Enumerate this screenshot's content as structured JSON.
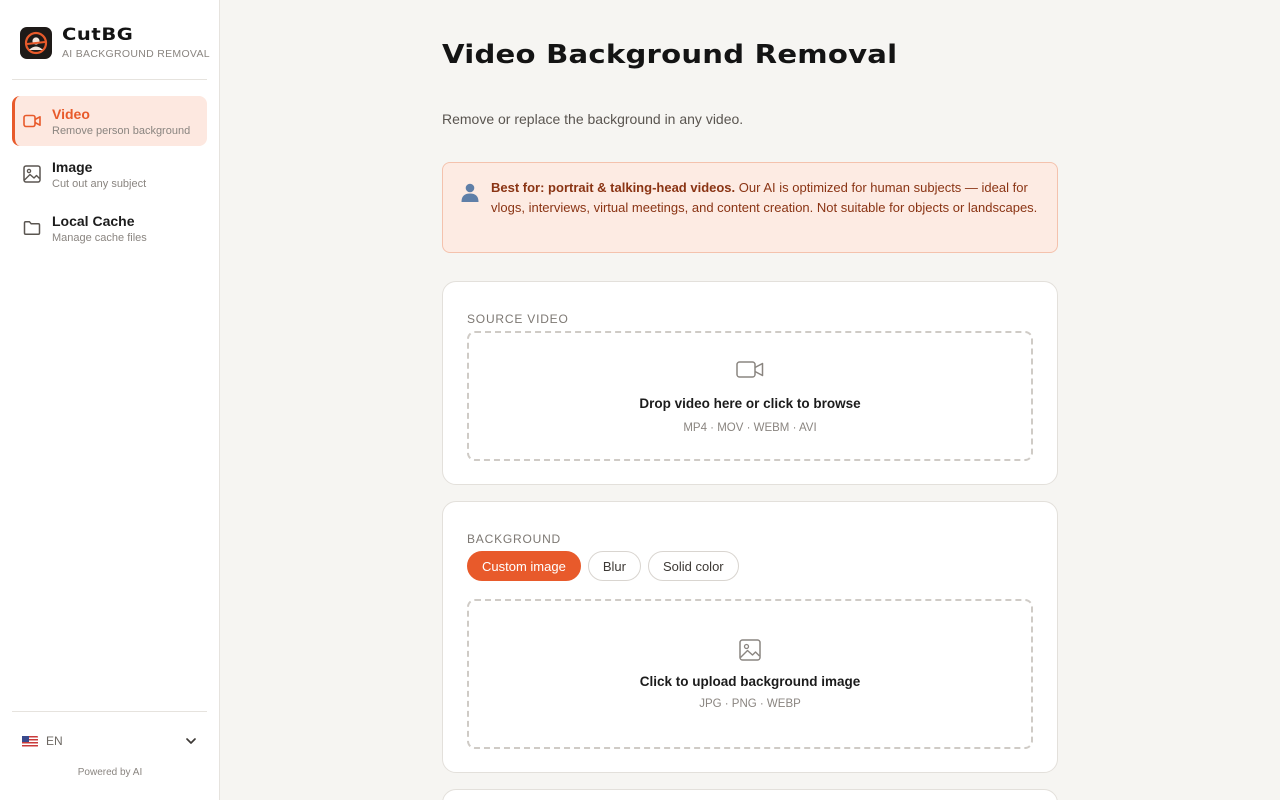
{
  "brand": {
    "name": "CutBG",
    "tagline": "AI BACKGROUND REMOVAL"
  },
  "sidebar": {
    "items": [
      {
        "title": "Video",
        "subtitle": "Remove person background",
        "icon": "video-camera-icon",
        "active": true
      },
      {
        "title": "Image",
        "subtitle": "Cut out any subject",
        "icon": "image-icon",
        "active": false
      },
      {
        "title": "Local Cache",
        "subtitle": "Manage cache files",
        "icon": "folder-icon",
        "active": false
      }
    ],
    "language": {
      "code": "EN",
      "flag": "us-flag-icon"
    },
    "powered_by": "Powered by AI"
  },
  "page": {
    "title": "Video Background Removal",
    "subtitle": "Remove or replace the background in any video."
  },
  "notice": {
    "icon": "person-icon",
    "bold": "Best for: portrait & talking-head videos.",
    "text": " Our AI is optimized for human subjects — ideal for vlogs, interviews, virtual meetings, and content creation. Not suitable for objects or landscapes."
  },
  "source_video": {
    "label": "SOURCE VIDEO",
    "drop_title": "Drop video here or click to browse",
    "formats": "MP4 · MOV · WEBM · AVI"
  },
  "background": {
    "label": "BACKGROUND",
    "tabs": [
      {
        "label": "Custom image",
        "active": true
      },
      {
        "label": "Blur",
        "active": false
      },
      {
        "label": "Solid color",
        "active": false
      }
    ],
    "upload_title": "Click to upload background image",
    "formats": "JPG · PNG · WEBP"
  },
  "colors": {
    "accent": "#e85a2b",
    "notice_bg": "#fdebe3",
    "page_bg": "#f6f5f2"
  }
}
